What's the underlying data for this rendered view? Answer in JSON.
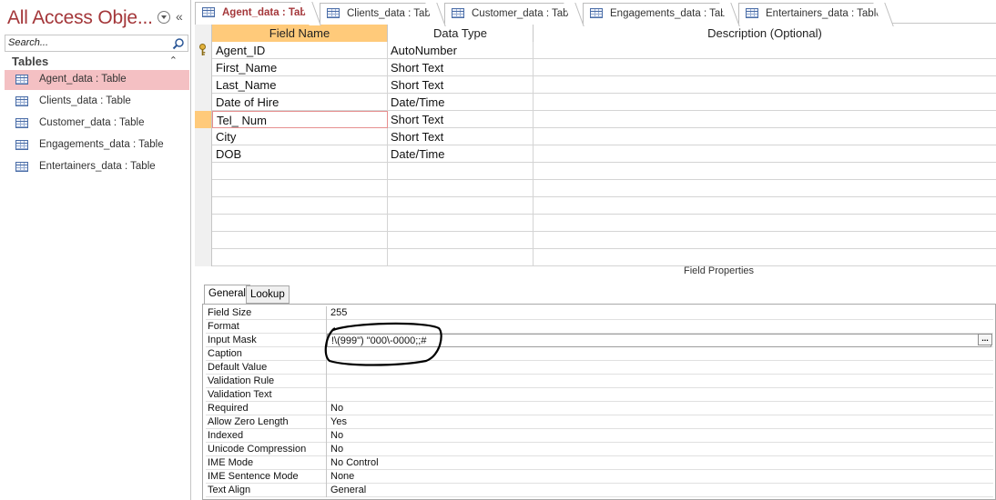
{
  "nav": {
    "title": "All Access Obje...",
    "search_placeholder": "Search...",
    "group_label": "Tables",
    "items": [
      {
        "label": "Agent_data : Table",
        "selected": true
      },
      {
        "label": "Clients_data : Table",
        "selected": false
      },
      {
        "label": "Customer_data : Table",
        "selected": false
      },
      {
        "label": "Engagements_data : Table",
        "selected": false
      },
      {
        "label": "Entertainers_data : Table",
        "selected": false
      }
    ]
  },
  "tabs": [
    {
      "label": "Agent_data : Table",
      "active": true
    },
    {
      "label": "Clients_data : Table",
      "active": false
    },
    {
      "label": "Customer_data : Table",
      "active": false
    },
    {
      "label": "Engagements_data : Table",
      "active": false
    },
    {
      "label": "Entertainers_data : Table",
      "active": false
    }
  ],
  "grid": {
    "headers": {
      "field_name": "Field Name",
      "data_type": "Data Type",
      "description": "Description (Optional)"
    },
    "rows": [
      {
        "field": "Agent_ID",
        "type": "AutoNumber",
        "primary_key": true
      },
      {
        "field": "First_Name",
        "type": "Short Text"
      },
      {
        "field": "Last_Name",
        "type": "Short Text"
      },
      {
        "field": "Date of Hire",
        "type": "Date/Time"
      },
      {
        "field": "Tel_ Num",
        "type": "Short Text",
        "current": true
      },
      {
        "field": "City",
        "type": "Short Text"
      },
      {
        "field": "DOB",
        "type": "Date/Time"
      }
    ]
  },
  "field_properties": {
    "label": "Field Properties",
    "tabs": {
      "general": "General",
      "lookup": "Lookup"
    },
    "rows": [
      {
        "name": "Field Size",
        "value": "255"
      },
      {
        "name": "Format",
        "value": ""
      },
      {
        "name": "Input Mask",
        "value": "!\\(999\") \"000\\-0000;;#"
      },
      {
        "name": "Caption",
        "value": ""
      },
      {
        "name": "Default Value",
        "value": ""
      },
      {
        "name": "Validation Rule",
        "value": ""
      },
      {
        "name": "Validation Text",
        "value": ""
      },
      {
        "name": "Required",
        "value": "No"
      },
      {
        "name": "Allow Zero Length",
        "value": "Yes"
      },
      {
        "name": "Indexed",
        "value": "No"
      },
      {
        "name": "Unicode Compression",
        "value": "No"
      },
      {
        "name": "IME Mode",
        "value": "No Control"
      },
      {
        "name": "IME Sentence Mode",
        "value": "None"
      },
      {
        "name": "Text Align",
        "value": "General"
      }
    ],
    "builder_button": "..."
  },
  "colors": {
    "accent": "#a4373a",
    "selected_nav": "#f4c0c3",
    "header_highlight": "#ffca7a"
  }
}
